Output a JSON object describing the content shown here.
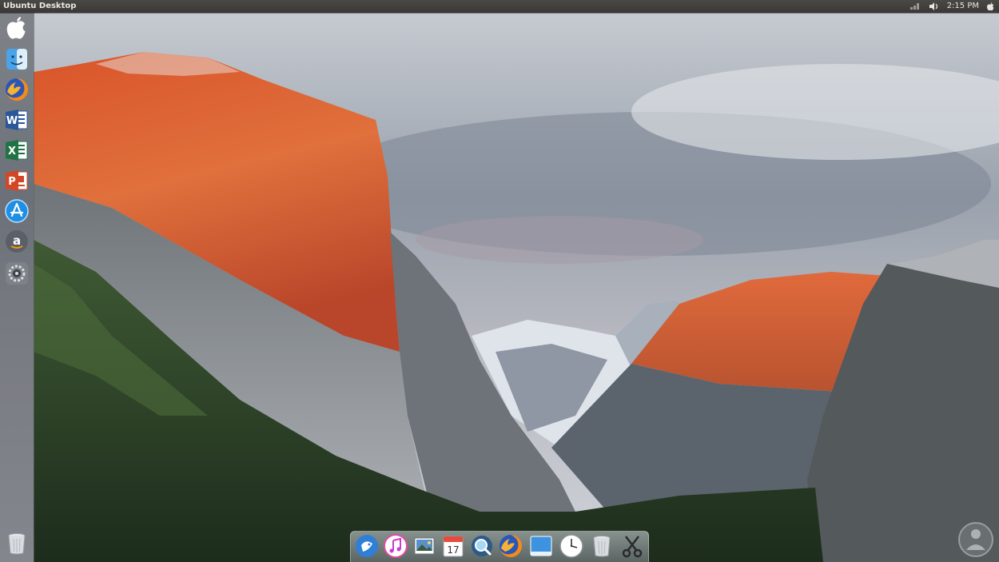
{
  "panel": {
    "title": "Ubuntu Desktop",
    "clock": "2:15 PM",
    "indicators": [
      "network-icon",
      "volume-icon",
      "apple-menu-icon"
    ]
  },
  "launcher": {
    "items": [
      {
        "name": "apple-logo",
        "icon": "apple-icon"
      },
      {
        "name": "finder",
        "icon": "finder-icon"
      },
      {
        "name": "firefox",
        "icon": "firefox-icon"
      },
      {
        "name": "word",
        "icon": "word-icon",
        "letter": "W"
      },
      {
        "name": "excel",
        "icon": "excel-icon",
        "letter": "X"
      },
      {
        "name": "powerpoint",
        "icon": "powerpoint-icon",
        "letter": "P"
      },
      {
        "name": "app-store",
        "icon": "app-store-icon"
      },
      {
        "name": "amazon",
        "icon": "amazon-icon",
        "letter": "a"
      },
      {
        "name": "system-settings",
        "icon": "gear-icon"
      },
      {
        "name": "trash",
        "icon": "trash-icon"
      }
    ]
  },
  "dock": {
    "calendar_day": "17",
    "items": [
      {
        "name": "finder",
        "icon": "finder-icon"
      },
      {
        "name": "itunes",
        "icon": "music-icon"
      },
      {
        "name": "photos",
        "icon": "photos-icon"
      },
      {
        "name": "calendar",
        "icon": "calendar-icon"
      },
      {
        "name": "search",
        "icon": "search-icon"
      },
      {
        "name": "firefox",
        "icon": "firefox-icon"
      },
      {
        "name": "desktop",
        "icon": "desktop-icon"
      },
      {
        "name": "clock",
        "icon": "clock-icon"
      },
      {
        "name": "trash",
        "icon": "trash-icon"
      },
      {
        "name": "screenshot-tool",
        "icon": "scissors-icon"
      }
    ]
  },
  "colors": {
    "panel": "#3c3b37",
    "accent_orange": "#e8632b",
    "word_blue": "#2b579a",
    "excel_green": "#217346",
    "powerpoint_red": "#d24726"
  }
}
